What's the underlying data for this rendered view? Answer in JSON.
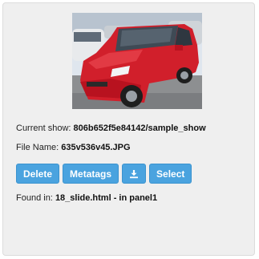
{
  "image": {
    "alt": "red car",
    "colors": {
      "body": "#d11f2b",
      "sky": "#dfe6ee",
      "ground": "#8d8f91"
    }
  },
  "current_show": {
    "label": "Current show:",
    "value": "806b652f5e84142/sample_show"
  },
  "file_name": {
    "label": "File Name:",
    "value": "635v536v45.JPG"
  },
  "buttons": {
    "delete": "Delete",
    "metatags": "Metatags",
    "download_icon": "download-icon",
    "select": "Select"
  },
  "found_in": {
    "label": "Found in:",
    "value": "18_slide.html - in panel1"
  },
  "colors": {
    "button": "#4aa3df",
    "panel": "#efefef"
  }
}
